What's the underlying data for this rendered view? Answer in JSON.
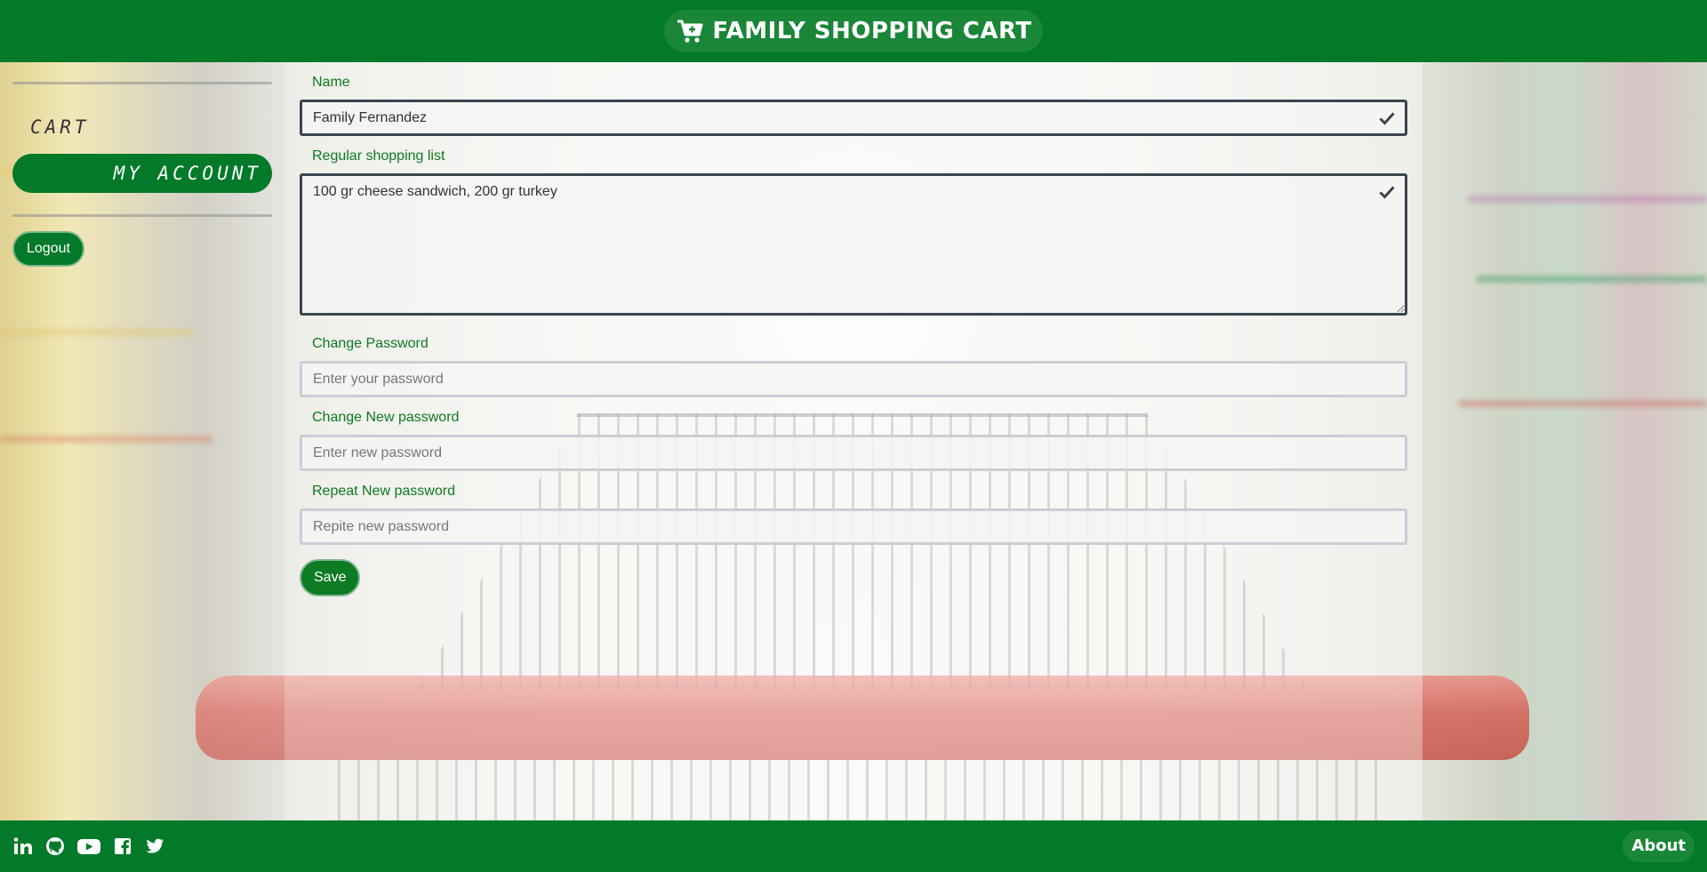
{
  "header": {
    "brand_icon": "cart-plus-icon",
    "brand_title": "FAMILY SHOPPING CART"
  },
  "sidebar": {
    "items": [
      {
        "label": "CART",
        "active": false
      },
      {
        "label": "MY ACCOUNT",
        "active": true
      }
    ],
    "logout_label": "Logout"
  },
  "form": {
    "name": {
      "label": "Name",
      "value": "Family Fernandez",
      "icon": "checkmark-icon"
    },
    "shopping_list": {
      "label": "Regular shopping list",
      "value": "100 gr cheese sandwich, 200 gr turkey",
      "icon": "checkmark-icon"
    },
    "change_password": {
      "label": "Change Password",
      "placeholder": "Enter your password"
    },
    "new_password": {
      "label": "Change New password",
      "placeholder": "Enter new password"
    },
    "repeat_password": {
      "label": "Repeat New password",
      "placeholder": "Repite new password"
    },
    "save_label": "Save"
  },
  "footer": {
    "socials": [
      "linkedin-icon",
      "github-icon",
      "youtube-icon",
      "facebook-icon",
      "twitter-icon"
    ],
    "about_label": "About"
  },
  "colors": {
    "brand_green": "#027a29",
    "label_green": "#0f7a1f",
    "valid_border": "#3a4450"
  }
}
